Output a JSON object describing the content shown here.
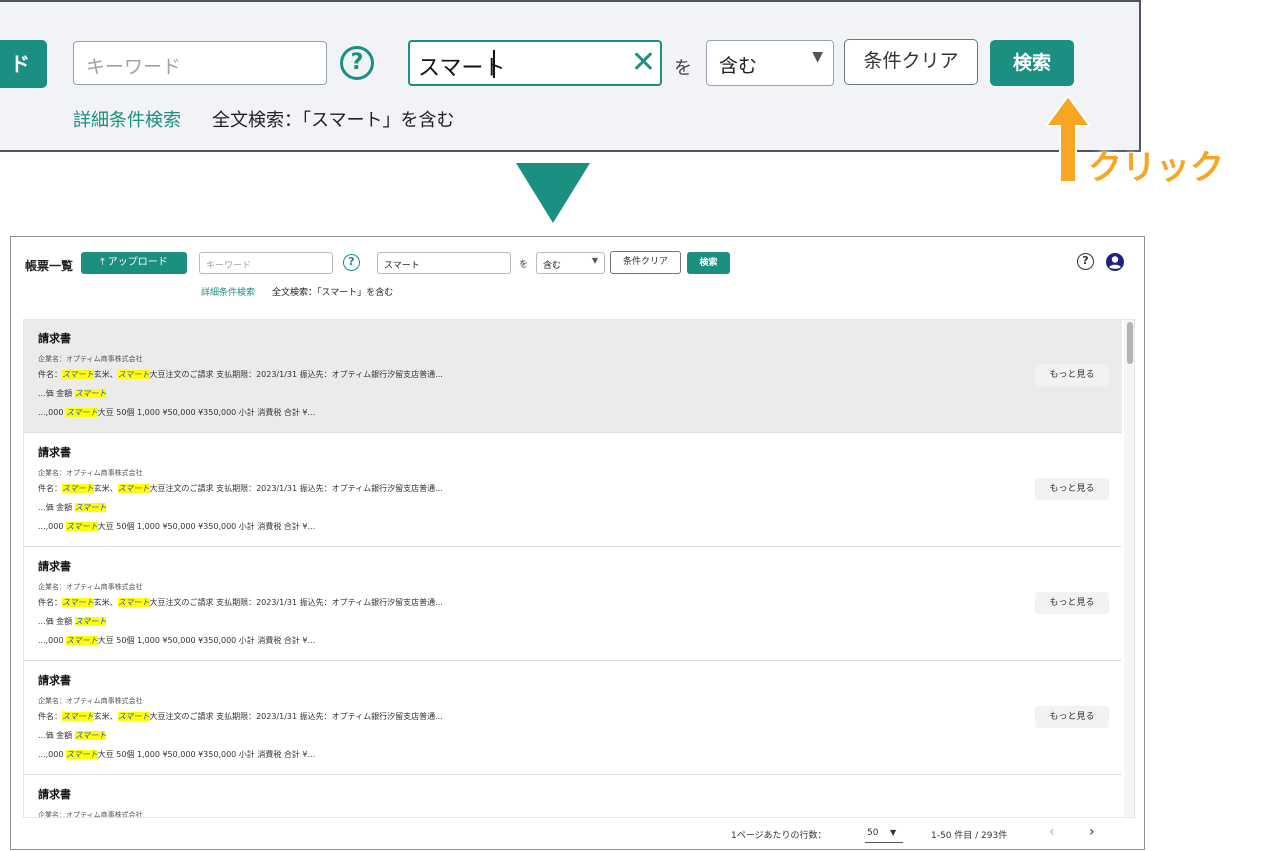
{
  "zoom": {
    "upload_fragment": "ド",
    "keyword_placeholder": "キーワード",
    "help": "?",
    "search_value": "スマート",
    "clear_x": "✕",
    "wo": "を",
    "match_value": "含む",
    "clear_label": "条件クリア",
    "search_label": "検索",
    "advanced_link": "詳細条件検索",
    "fulltext_summary": "全文検索：「スマート」を含む"
  },
  "annotation": {
    "click_label": "クリック",
    "arrow_color": "#f6a623",
    "triangle_color": "#1b8f80"
  },
  "header": {
    "title": "帳票一覧",
    "upload_label": "⤒ アップロード",
    "keyword_placeholder": "キーワード",
    "help": "?",
    "search_value": "スマート",
    "wo": "を",
    "match_value": "含む",
    "clear_label": "条件クリア",
    "search_label": "検索",
    "advanced_link": "詳細条件検索",
    "fulltext_summary": "全文検索：「スマート」を含む",
    "right_help": "?",
    "account_icon": "account-icon"
  },
  "results": [
    {
      "title": "請求書",
      "company": "企業名：オプティム商事株式会社",
      "l1_pre": "件名：",
      "hl": "スマート",
      "l1_mid": "玄米、",
      "l1_post": "大豆注文のご請求 支払期限：2023/1/31 振込先：オプティム銀行汐留支店普通...",
      "l2_pre": "...価 金額 ",
      "l3_pre": "...,000 ",
      "l3_post": "大豆 50個 1,000 ¥50,000 ¥350,000 小計 消費税 合計 ¥...",
      "more": "もっと見る"
    },
    {
      "title": "請求書",
      "company": "企業名：オプティム商事株式会社",
      "l1_pre": "件名：",
      "hl": "スマート",
      "l1_mid": "玄米、",
      "l1_post": "大豆注文のご請求 支払期限：2023/1/31 振込先：オプティム銀行汐留支店普通...",
      "l2_pre": "...価 金額 ",
      "l3_pre": "...,000 ",
      "l3_post": "大豆 50個 1,000 ¥50,000 ¥350,000 小計 消費税 合計 ¥...",
      "more": "もっと見る"
    },
    {
      "title": "請求書",
      "company": "企業名：オプティム商事株式会社",
      "l1_pre": "件名：",
      "hl": "スマート",
      "l1_mid": "玄米、",
      "l1_post": "大豆注文のご請求 支払期限：2023/1/31 振込先：オプティム銀行汐留支店普通...",
      "l2_pre": "...価 金額 ",
      "l3_pre": "...,000 ",
      "l3_post": "大豆 50個 1,000 ¥50,000 ¥350,000 小計 消費税 合計 ¥...",
      "more": "もっと見る"
    },
    {
      "title": "請求書",
      "company": "企業名：オプティム商事株式会社",
      "l1_pre": "件名：",
      "hl": "スマート",
      "l1_mid": "玄米、",
      "l1_post": "大豆注文のご請求 支払期限：2023/1/31 振込先：オプティム銀行汐留支店普通...",
      "l2_pre": "...価 金額 ",
      "l3_pre": "...,000 ",
      "l3_post": "大豆 50個 1,000 ¥50,000 ¥350,000 小計 消費税 合計 ¥...",
      "more": "もっと見る"
    },
    {
      "title": "請求書",
      "company": "企業名：オプティム商事株式会社"
    }
  ],
  "pager": {
    "rows_label": "1ページあたりの行数：",
    "rows_value": "50",
    "range_label": "1-50 件目 / 293件",
    "prev": "‹",
    "next": "›"
  },
  "colors": {
    "accent": "#1b8f80",
    "highlight": "#ffff00",
    "selected_row": "#ebebeb"
  }
}
